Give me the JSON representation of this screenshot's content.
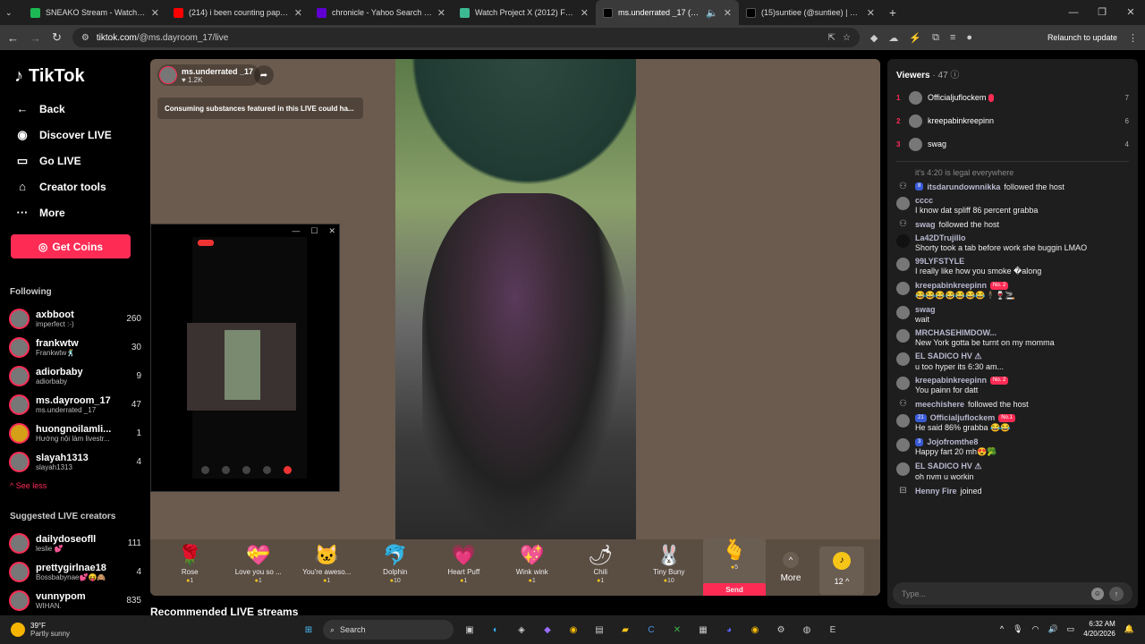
{
  "browser": {
    "tabs": [
      {
        "title": "SNEAKO Stream - Watch Live o",
        "color": "#1db954"
      },
      {
        "title": "(214) i been counting paper i g",
        "color": "#ff0000"
      },
      {
        "title": "chronicle - Yahoo Search Result",
        "color": "#6001d2"
      },
      {
        "title": "Watch Project X (2012) For Free",
        "color": "#3cba92"
      },
      {
        "title": "ms.underrated _17 (@ms.d",
        "color": "#000000"
      },
      {
        "title": "(15)suntiee (@suntiee) | TikTok",
        "color": "#000000"
      }
    ],
    "new_tab": "+",
    "url_domain": "tiktok.com",
    "url_path": "/@ms.dayroom_17/live",
    "relaunch": "Relaunch to update"
  },
  "sidebar": {
    "logo": "TikTok",
    "back": "Back",
    "nav": [
      {
        "label": "Discover LIVE",
        "icon": "live-icon"
      },
      {
        "label": "Go LIVE",
        "icon": "camera-icon"
      },
      {
        "label": "Creator tools",
        "icon": "home-icon"
      },
      {
        "label": "More",
        "icon": "more-icon"
      }
    ],
    "get_coins": "Get Coins",
    "following_title": "Following",
    "following": [
      {
        "name": "axbboot",
        "sub": "imperfect :-)",
        "count": "260"
      },
      {
        "name": "frankwtw",
        "sub": "Frankwtw🕺",
        "count": "30"
      },
      {
        "name": "adiorbaby",
        "sub": "adiorbaby",
        "count": "9"
      },
      {
        "name": "ms.dayroom_17",
        "sub": "ms.underrated _17",
        "count": "47"
      },
      {
        "name": "huongnoilamli...",
        "sub": "Hướng nội làm livestr...",
        "count": "1"
      },
      {
        "name": "slayah1313",
        "sub": "slayah1313",
        "count": "4"
      }
    ],
    "see_less": "See less",
    "suggested_title": "Suggested LIVE creators",
    "suggested": [
      {
        "name": "dailydoseofll",
        "sub": "leslie 💕",
        "count": "111"
      },
      {
        "name": "prettygirlnae18",
        "sub": "Bossbabynae💕😝🙈",
        "count": "4"
      },
      {
        "name": "vunnypom",
        "sub": "WIHAN.",
        "count": "835"
      }
    ]
  },
  "stream": {
    "host_name": "ms.underrated _17",
    "likes": "1.2K",
    "warning": "Consuming substances featured in this LIVE could ha...",
    "gifts": [
      {
        "name": "Rose",
        "price": "1",
        "icon": "🌹"
      },
      {
        "name": "Love you so ...",
        "price": "1",
        "icon": "💝"
      },
      {
        "name": "You're aweso...",
        "price": "1",
        "icon": "🐱"
      },
      {
        "name": "Dolphin",
        "price": "10",
        "icon": "🐬"
      },
      {
        "name": "Heart Puff",
        "price": "1",
        "icon": "💗"
      },
      {
        "name": "Wink wink",
        "price": "1",
        "icon": "💖"
      },
      {
        "name": "Chili",
        "price": "1",
        "icon": "🌶"
      },
      {
        "name": "Tiny Buny",
        "price": "10",
        "icon": "🐰"
      }
    ],
    "selected_gift_price": "5",
    "send": "Send",
    "more": "More",
    "coins": "12",
    "recommended": "Recommended LIVE streams"
  },
  "chat": {
    "viewers_label": "Viewers",
    "viewers_count": "· 47",
    "top_viewers": [
      {
        "rank": "1",
        "name": "Officialjuflockem",
        "count": "7"
      },
      {
        "rank": "2",
        "name": "kreepabinkreepinn",
        "count": "6"
      },
      {
        "rank": "3",
        "name": "swag",
        "count": "4"
      }
    ],
    "messages": [
      {
        "type": "faded",
        "text": "it's 4:20 is legal everywhere"
      },
      {
        "type": "event",
        "name": "itsdarundownnikka",
        "text": "followed the host",
        "badge": "8"
      },
      {
        "type": "msg",
        "name": "cccc",
        "text": "I know dat spliff 86 percent grabba"
      },
      {
        "type": "event",
        "name": "swag",
        "text": "followed the host"
      },
      {
        "type": "msg",
        "name": "La42DTrujillo",
        "text": "Shorty took a tab before work she buggin LMAO"
      },
      {
        "type": "msg",
        "name": "99LYFSTYLE",
        "text": "I really like how you smoke �along"
      },
      {
        "type": "msg",
        "name": "kreepabinkreepinn",
        "tag": "No. 2",
        "text": "😂😂😂😂😂😂😂🕴🍷🚬"
      },
      {
        "type": "msg",
        "name": "swag",
        "text": "wait"
      },
      {
        "type": "msg",
        "name": "MRCHASEHIMDOW...",
        "text": "New York gotta be turnt on my momma"
      },
      {
        "type": "msg",
        "name": "EL SADICO HV ⚠",
        "text": "u too hyper its 6:30 am..."
      },
      {
        "type": "msg",
        "name": "kreepabinkreepinn",
        "tag": "No. 2",
        "text": "You painn for datt"
      },
      {
        "type": "event",
        "name": "meechishere",
        "text": "followed the host"
      },
      {
        "type": "msg",
        "name": "Officialjuflockem",
        "tag": "No.1",
        "badge": "21",
        "text": "He said 86% grabba 😂😂"
      },
      {
        "type": "msg",
        "name": "Jojofromthe8",
        "badge": "3",
        "text": "Happy fart 20 mh😍🥦"
      },
      {
        "type": "msg",
        "name": "EL SADICO HV ⚠",
        "text": "oh nvm u workin"
      },
      {
        "type": "event",
        "name": "Henny Fire",
        "text": "joined"
      }
    ],
    "input_placeholder": "Type..."
  },
  "taskbar": {
    "temp": "39°F",
    "weather": "Partly sunny",
    "search": "Search",
    "time": "6:32 AM",
    "date": "4/20/2026"
  }
}
